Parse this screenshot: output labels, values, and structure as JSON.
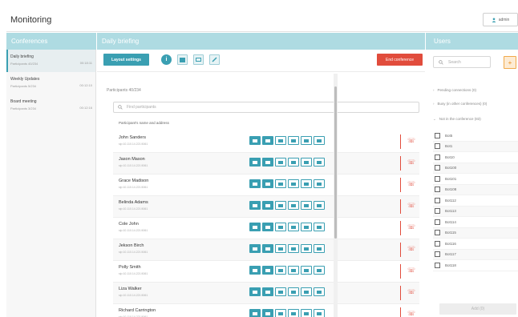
{
  "app": {
    "title": "Monitoring",
    "user_label": "admin"
  },
  "headers": {
    "conferences": "Conferences",
    "current": "Daily briefing",
    "users": "Users"
  },
  "conferences": [
    {
      "name": "Daily briefing",
      "participants": "Participants 40/234",
      "time": "00:18:11",
      "active": true
    },
    {
      "name": "Weekly Updates",
      "participants": "Participants 5/234",
      "time": "00:12:10",
      "active": false
    },
    {
      "name": "Board meeting",
      "participants": "Participants 3/234",
      "time": "00:12:16",
      "active": false
    }
  ],
  "toolbar": {
    "layout_label": "Layout settings",
    "end_label": "End conference",
    "icons": [
      "info-icon",
      "layout-icon",
      "chat-icon",
      "share-icon"
    ]
  },
  "participants": {
    "count_label": "Participants 40/234",
    "search_placeholder": "Find participants",
    "column_header": "Participant's name and address",
    "controls": [
      "camera-icon",
      "microphone-icon",
      "speaker-icon",
      "screen-share-icon",
      "video-layout-icon",
      "more-icon"
    ],
    "items": [
      {
        "name": "John Sanders",
        "address": "sip:10.110.14.221:5061"
      },
      {
        "name": "Jason Mason",
        "address": "sip:10.110.14.221:5061"
      },
      {
        "name": "Grace Madison",
        "address": "sip:10.110.14.221:5061"
      },
      {
        "name": "Belinda Adams",
        "address": "sip:10.110.14.221:5061"
      },
      {
        "name": "Cole John",
        "address": "sip:10.110.14.221:5061"
      },
      {
        "name": "Jekson Birch",
        "address": "sip:10.110.14.221:5061"
      },
      {
        "name": "Polly Smith",
        "address": "sip:10.110.14.221:5061"
      },
      {
        "name": "Liza Walker",
        "address": "sip:10.110.14.221:5061"
      },
      {
        "name": "Richard Carrington",
        "address": "sip:10.110.14.221:5061"
      }
    ]
  },
  "users": {
    "search_placeholder": "Search",
    "sections": [
      {
        "label": "Pending connections (0)",
        "expanded": false
      },
      {
        "label": "Busy (in other conferences) (0)",
        "expanded": false
      },
      {
        "label": "Not in the conference (83)",
        "expanded": true
      }
    ],
    "items": [
      "Bot5",
      "Bot1",
      "Bot10",
      "Bot100",
      "Bot101",
      "Bot108",
      "Bot112",
      "Bot113",
      "Bot114",
      "Bot115",
      "Bot116",
      "Bot117",
      "Bot118"
    ],
    "add_label": "Add (0)"
  },
  "colors": {
    "accent": "#3a9fb2",
    "header": "#aedbe2",
    "danger": "#e14c3c",
    "warn": "#f0a94a"
  }
}
